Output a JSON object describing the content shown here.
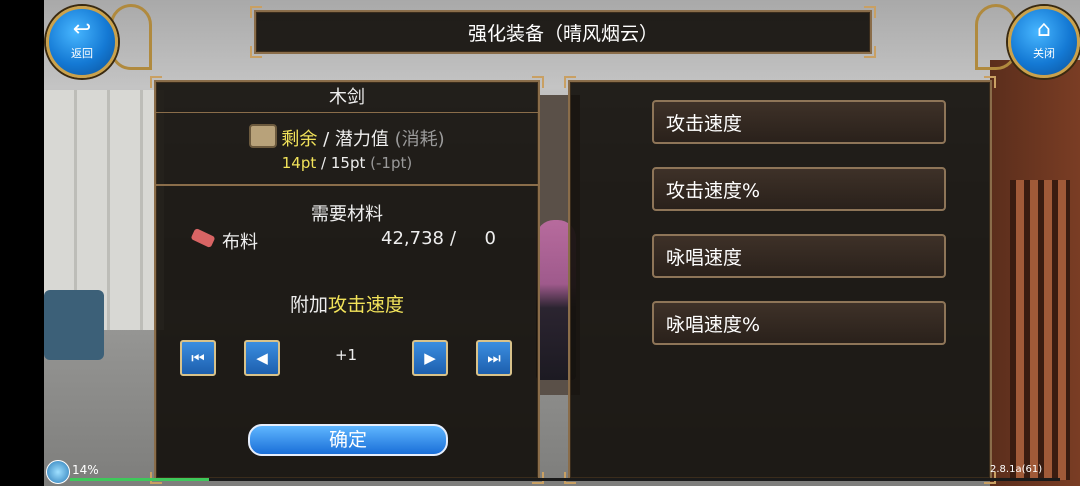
{
  "header": {
    "title": "强化装备（晴风烟云）"
  },
  "nav": {
    "back_label": "返回",
    "close_label": "关闭",
    "back_icon": "↩",
    "close_icon": "⌂"
  },
  "item": {
    "name": "木剑",
    "points": {
      "remaining_label": "剩余",
      "separator": "/",
      "potential_label": "潜力值",
      "cost_label": "(消耗)",
      "remaining_value": "14pt",
      "potential_value": "15pt",
      "cost_value": "(-1pt)"
    },
    "materials_title": "需要材料",
    "materials": [
      {
        "name": "布料",
        "have": "42,738",
        "separator": "/",
        "need": "0"
      }
    ]
  },
  "enhance": {
    "prefix": "附加",
    "stat": "攻击速度",
    "step_value": "+1",
    "confirm_label": "确定",
    "step_icons": {
      "first": "⏮",
      "prev": "◀",
      "next": "▶",
      "last": "⏭"
    }
  },
  "stats": [
    "攻击速度",
    "攻击速度%",
    "咏唱速度",
    "咏唱速度%"
  ],
  "status": {
    "percent": "14%",
    "progress_fraction": 0.14,
    "version": "2.8.1a(61)"
  },
  "colors": {
    "highlight": "#f2e35a",
    "panel_border": "#8a6d4a",
    "button_blue": "#1a6fd8"
  }
}
